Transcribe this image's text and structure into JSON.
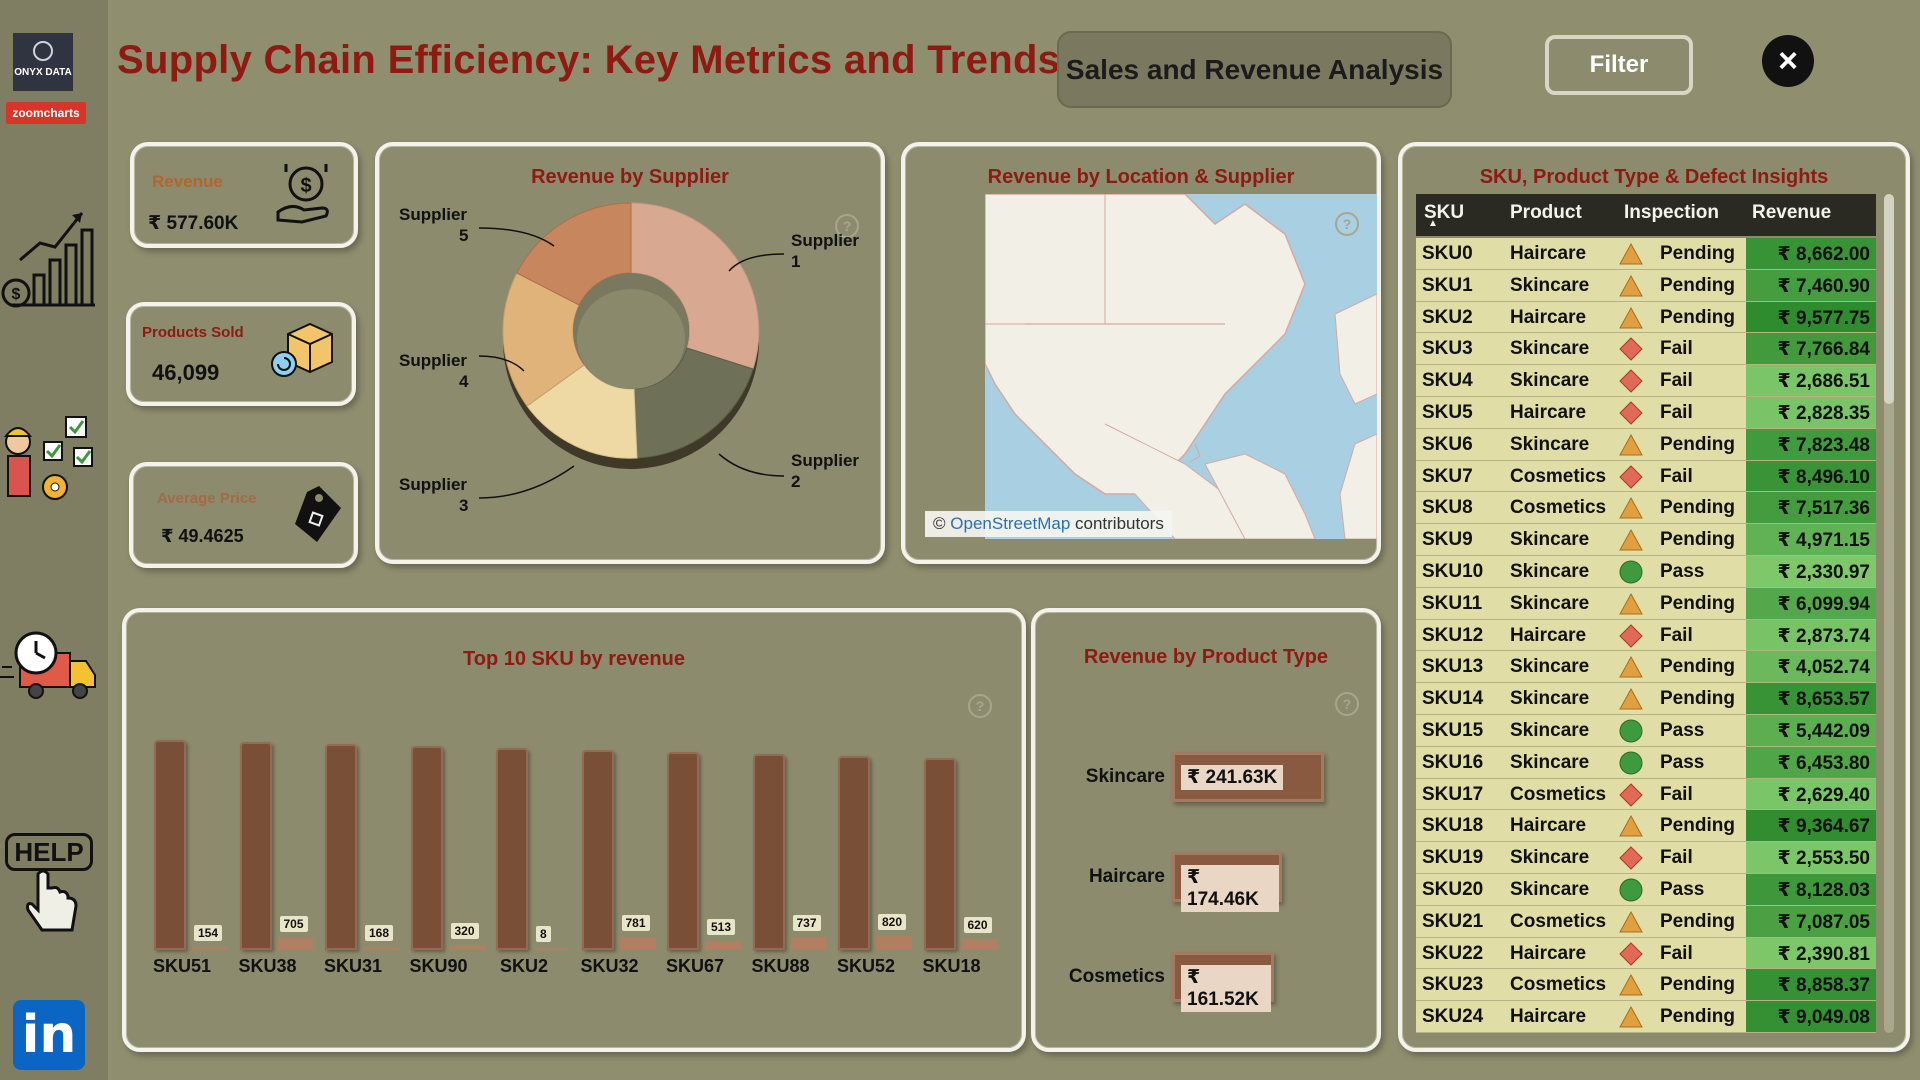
{
  "rail": {
    "brand_logo": "ONYX DATA",
    "partner_logo": "zoomcharts",
    "help_label": "HELP",
    "linkedin_label": "in"
  },
  "header": {
    "title": "Supply Chain Efficiency: Key Metrics and Trends",
    "nav_button": "Sales and Revenue Analysis",
    "filter_button": "Filter",
    "close_icon": "×"
  },
  "kpis": {
    "revenue": {
      "label": "Revenue",
      "value": "₹ 577.60K",
      "label_color": "#b5632f"
    },
    "products_sold": {
      "label": "Products Sold",
      "value": "46,099",
      "label_color": "#8e1a12"
    },
    "average_price": {
      "label": "Average Price",
      "value": "₹ 49.4625",
      "label_color": "#a26b45"
    }
  },
  "revenue_by_supplier": {
    "title": "Revenue by Supplier",
    "labels": [
      {
        "line1": "Supplier",
        "line2": "1"
      },
      {
        "line1": "Supplier",
        "line2": "2"
      },
      {
        "line1": "Supplier",
        "line2": "3"
      },
      {
        "line1": "Supplier",
        "line2": "4"
      },
      {
        "line1": "Supplier",
        "line2": "5"
      }
    ]
  },
  "map_card": {
    "title": "Revenue by Location & Supplier",
    "attribution_prefix": "©",
    "attribution_link": "OpenStreetMap",
    "attribution_suffix": "contributors"
  },
  "table": {
    "title": "SKU, Product Type & Defect Insights",
    "headers": [
      "SKU",
      "Product",
      "Inspection",
      "Revenue"
    ],
    "rows": [
      {
        "sku": "SKU0",
        "product": "Haircare",
        "inspection": "Pending",
        "revenue": "₹ 8,662.00"
      },
      {
        "sku": "SKU1",
        "product": "Skincare",
        "inspection": "Pending",
        "revenue": "₹ 7,460.90"
      },
      {
        "sku": "SKU2",
        "product": "Haircare",
        "inspection": "Pending",
        "revenue": "₹ 9,577.75"
      },
      {
        "sku": "SKU3",
        "product": "Skincare",
        "inspection": "Fail",
        "revenue": "₹ 7,766.84"
      },
      {
        "sku": "SKU4",
        "product": "Skincare",
        "inspection": "Fail",
        "revenue": "₹ 2,686.51"
      },
      {
        "sku": "SKU5",
        "product": "Haircare",
        "inspection": "Fail",
        "revenue": "₹ 2,828.35"
      },
      {
        "sku": "SKU6",
        "product": "Skincare",
        "inspection": "Pending",
        "revenue": "₹ 7,823.48"
      },
      {
        "sku": "SKU7",
        "product": "Cosmetics",
        "inspection": "Fail",
        "revenue": "₹ 8,496.10"
      },
      {
        "sku": "SKU8",
        "product": "Cosmetics",
        "inspection": "Pending",
        "revenue": "₹ 7,517.36"
      },
      {
        "sku": "SKU9",
        "product": "Skincare",
        "inspection": "Pending",
        "revenue": "₹ 4,971.15"
      },
      {
        "sku": "SKU10",
        "product": "Skincare",
        "inspection": "Pass",
        "revenue": "₹ 2,330.97"
      },
      {
        "sku": "SKU11",
        "product": "Skincare",
        "inspection": "Pending",
        "revenue": "₹ 6,099.94"
      },
      {
        "sku": "SKU12",
        "product": "Haircare",
        "inspection": "Fail",
        "revenue": "₹ 2,873.74"
      },
      {
        "sku": "SKU13",
        "product": "Skincare",
        "inspection": "Pending",
        "revenue": "₹ 4,052.74"
      },
      {
        "sku": "SKU14",
        "product": "Skincare",
        "inspection": "Pending",
        "revenue": "₹ 8,653.57"
      },
      {
        "sku": "SKU15",
        "product": "Skincare",
        "inspection": "Pass",
        "revenue": "₹ 5,442.09"
      },
      {
        "sku": "SKU16",
        "product": "Skincare",
        "inspection": "Pass",
        "revenue": "₹ 6,453.80"
      },
      {
        "sku": "SKU17",
        "product": "Cosmetics",
        "inspection": "Fail",
        "revenue": "₹ 2,629.40"
      },
      {
        "sku": "SKU18",
        "product": "Haircare",
        "inspection": "Pending",
        "revenue": "₹ 9,364.67"
      },
      {
        "sku": "SKU19",
        "product": "Skincare",
        "inspection": "Fail",
        "revenue": "₹ 2,553.50"
      },
      {
        "sku": "SKU20",
        "product": "Skincare",
        "inspection": "Pass",
        "revenue": "₹ 8,128.03"
      },
      {
        "sku": "SKU21",
        "product": "Cosmetics",
        "inspection": "Pending",
        "revenue": "₹ 7,087.05"
      },
      {
        "sku": "SKU22",
        "product": "Haircare",
        "inspection": "Fail",
        "revenue": "₹ 2,390.81"
      },
      {
        "sku": "SKU23",
        "product": "Cosmetics",
        "inspection": "Pending",
        "revenue": "₹ 8,858.37"
      },
      {
        "sku": "SKU24",
        "product": "Haircare",
        "inspection": "Pending",
        "revenue": "₹ 9,049.08"
      }
    ]
  },
  "top_sku": {
    "title": "Top 10 SKU by revenue",
    "skus": [
      "SKU51",
      "SKU38",
      "SKU31",
      "SKU90",
      "SKU2",
      "SKU32",
      "SKU67",
      "SKU88",
      "SKU52",
      "SKU18"
    ],
    "secondary_values": [
      154,
      705,
      168,
      320,
      8,
      781,
      513,
      737,
      820,
      620
    ]
  },
  "product_type": {
    "title": "Revenue by Product Type",
    "items": [
      {
        "name": "Skincare",
        "value": "₹ 241.63K"
      },
      {
        "name": "Haircare",
        "value": "₹ 174.46K"
      },
      {
        "name": "Cosmetics",
        "value": "₹ 161.52K"
      }
    ]
  },
  "colors": {
    "bg": "#8f8e6f",
    "title": "#8e1a12",
    "bar": "#8a5a40",
    "pass": "#3f9a3f",
    "pending": "#e0a040",
    "fail": "#e06a55",
    "rev_high": "#2e8b2e",
    "rev_low": "#7ec86a"
  }
}
